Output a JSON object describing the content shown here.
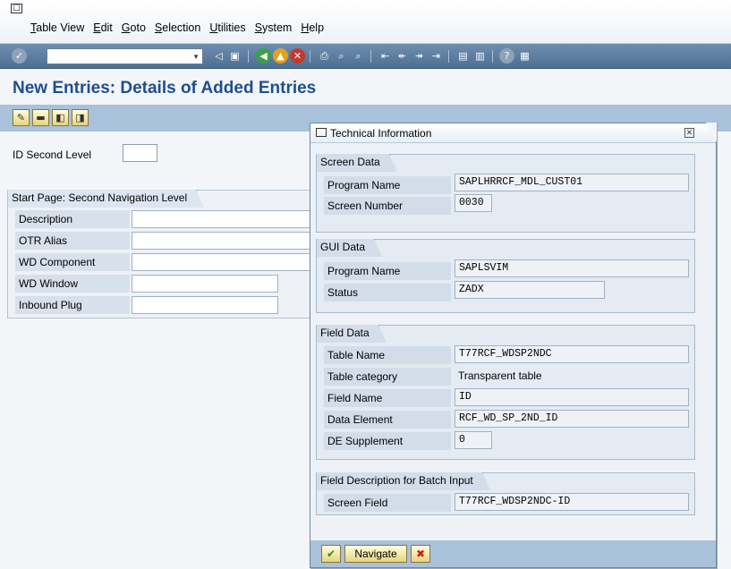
{
  "menubar": {
    "items": [
      "Table View",
      "Edit",
      "Goto",
      "Selection",
      "Utilities",
      "System",
      "Help"
    ]
  },
  "toolbar": {
    "command_field_value": "",
    "icons": [
      "enter-icon",
      "dropdown-icon",
      "back-icon",
      "save-icon",
      "back-nav-icon",
      "exit-icon",
      "cancel-icon",
      "print-icon",
      "find-icon",
      "find-next-icon",
      "first-page-icon",
      "previous-page-icon",
      "next-page-icon",
      "last-page-icon",
      "create-session-icon",
      "shortcut-icon",
      "help-icon",
      "layout-menu-icon"
    ]
  },
  "page": {
    "title": "New Entries: Details of Added Entries"
  },
  "app_toolbar": {
    "icons": [
      "display-change-icon",
      "delete-icon",
      "previous-entry-icon",
      "next-entry-icon"
    ]
  },
  "form": {
    "id_label": "ID Second Level",
    "id_value": "",
    "group_title": "Start Page: Second Navigation Level",
    "fields": [
      {
        "label": "Description",
        "value": ""
      },
      {
        "label": "OTR Alias",
        "value": ""
      },
      {
        "label": "WD Component",
        "value": ""
      },
      {
        "label": "WD Window",
        "value": ""
      },
      {
        "label": "Inbound Plug",
        "value": ""
      }
    ]
  },
  "dialog": {
    "title": "Technical Information",
    "screen_data": {
      "heading": "Screen Data",
      "program_name_label": "Program Name",
      "program_name": "SAPLHRRCF_MDL_CUST01",
      "screen_number_label": "Screen Number",
      "screen_number": "0030"
    },
    "gui_data": {
      "heading": "GUI Data",
      "program_name_label": "Program Name",
      "program_name": "SAPLSVIM",
      "status_label": "Status",
      "status": "ZADX"
    },
    "field_data": {
      "heading": "Field Data",
      "table_name_label": "Table Name",
      "table_name": "T77RCF_WDSP2NDC",
      "table_category_label": "Table category",
      "table_category": "Transparent table",
      "field_name_label": "Field Name",
      "field_name": "ID",
      "data_element_label": "Data Element",
      "data_element": "RCF_WD_SP_2ND_ID",
      "de_supplement_label": "DE Supplement",
      "de_supplement": "0"
    },
    "batch_input": {
      "heading": "Field Description for Batch Input",
      "screen_field_label": "Screen Field",
      "screen_field": "T77RCF_WDSP2NDC-ID"
    },
    "footer": {
      "navigate_label": "Navigate"
    }
  },
  "colors": {
    "title": "#1d4f8e",
    "toolbar": "#4d6f92",
    "app_toolbar": "#a9c1db"
  }
}
